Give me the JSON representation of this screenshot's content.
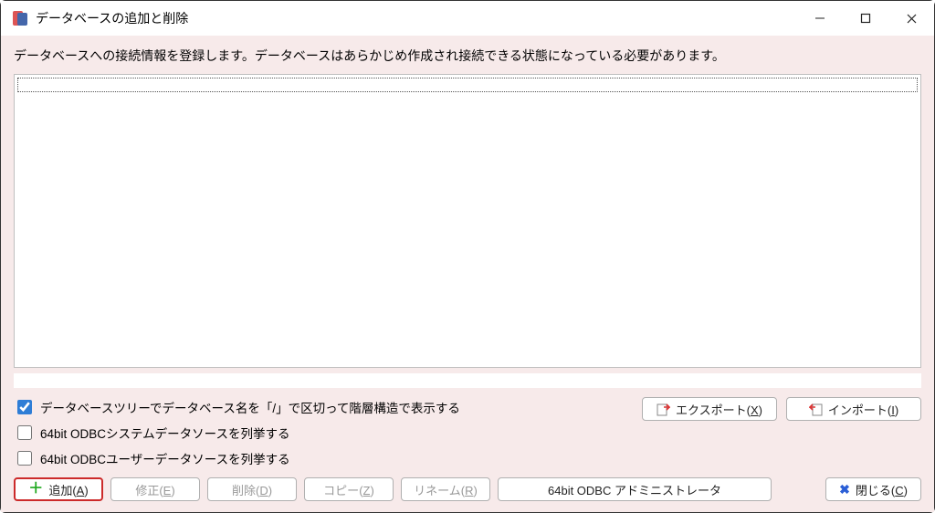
{
  "titlebar": {
    "title": "データベースの追加と削除"
  },
  "instructions": "データベースへの接続情報を登録します。データベースはあらかじめ作成され接続できる状態になっている必要があります。",
  "checkboxes": {
    "tree": {
      "label": "データベースツリーでデータベース名を「/」で区切って階層構造で表示する",
      "checked": true
    },
    "odbc_system": {
      "label": "64bit ODBCシステムデータソースを列挙する",
      "checked": false
    },
    "odbc_user": {
      "label": "64bit ODBCユーザーデータソースを列挙する",
      "checked": false
    }
  },
  "buttons": {
    "export": {
      "label": "エクスポート",
      "shortcut": "X"
    },
    "import": {
      "label": "インポート",
      "shortcut": "I"
    },
    "add": {
      "label": "追加",
      "shortcut": "A"
    },
    "edit": {
      "label": "修正",
      "shortcut": "E"
    },
    "delete": {
      "label": "削除",
      "shortcut": "D"
    },
    "copy": {
      "label": "コピー",
      "shortcut": "Z"
    },
    "rename": {
      "label": "リネーム",
      "shortcut": "R"
    },
    "odbc_admin": {
      "label": "64bit ODBC アドミニストレータ"
    },
    "close": {
      "label": "閉じる",
      "shortcut": "C"
    }
  }
}
